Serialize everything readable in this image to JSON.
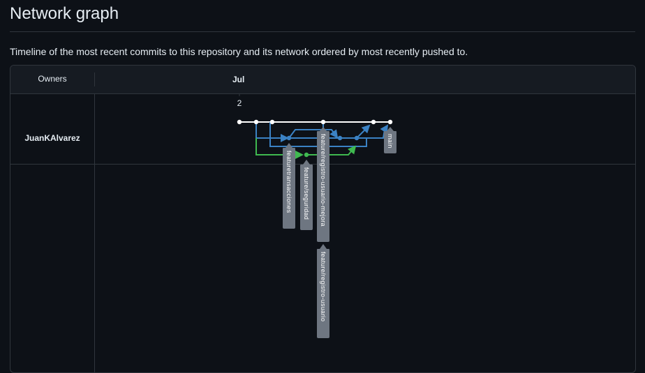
{
  "page": {
    "title": "Network graph",
    "description": "Timeline of the most recent commits to this repository and its network ordered by most recently pushed to."
  },
  "graph": {
    "owners_header": "Owners",
    "month": "Jul",
    "day": "2",
    "owner": "JuanKAlvarez",
    "branches": [
      "featuretransacciones",
      "feature/seguridad",
      "feature/registro-usuario-mejora",
      "feature/registro-usuario",
      "main"
    ],
    "colors": {
      "main": "#ffffff",
      "blue": "#3b82c4",
      "green": "#3fb950",
      "label_bg": "#6e7681"
    }
  }
}
